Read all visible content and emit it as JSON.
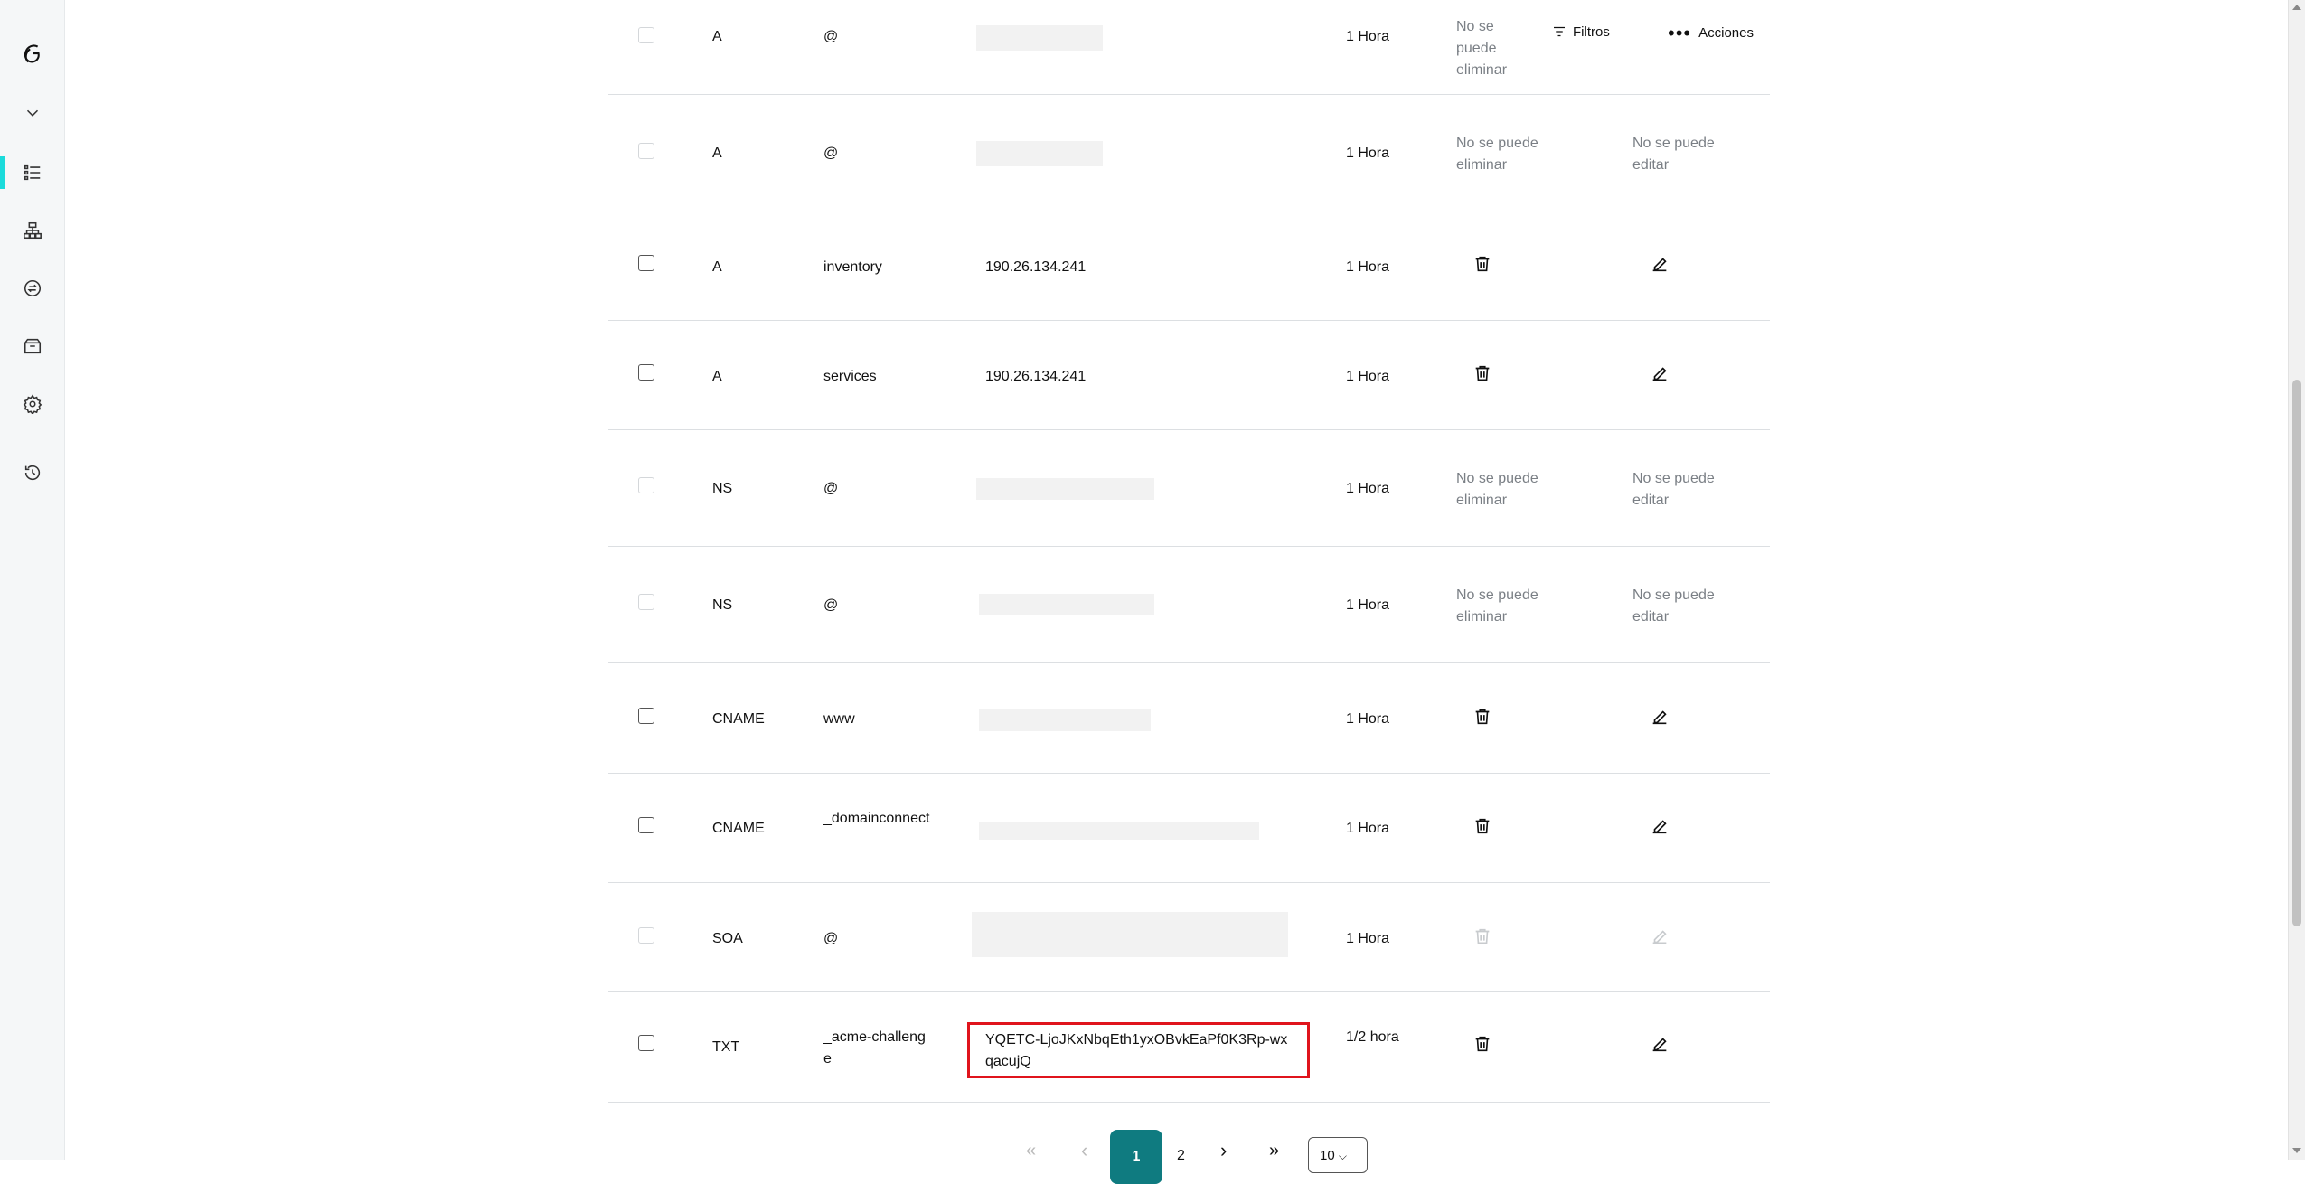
{
  "toolbar": {
    "filters_label": "Filtros",
    "actions_label": "Acciones"
  },
  "rail": {
    "items": [
      {
        "icon": "godaddy-logo-icon"
      },
      {
        "icon": "chevron-down-icon"
      },
      {
        "icon": "dns-records-icon",
        "active": true
      },
      {
        "icon": "hierarchy-icon"
      },
      {
        "icon": "transfer-icon"
      },
      {
        "icon": "box-icon"
      },
      {
        "icon": "gear-icon"
      },
      {
        "icon": "history-icon"
      }
    ]
  },
  "labels": {
    "cannot_delete": "No se puede eliminar",
    "cannot_edit": "No se puede editar"
  },
  "records": [
    {
      "type": "A",
      "name": "@",
      "value": "",
      "ttl": "1 Hora"
    },
    {
      "type": "A",
      "name": "@",
      "value": "",
      "ttl": "1 Hora"
    },
    {
      "type": "A",
      "name": "inventory",
      "value": "190.26.134.241",
      "ttl": "1 Hora"
    },
    {
      "type": "A",
      "name": "services",
      "value": "190.26.134.241",
      "ttl": "1 Hora"
    },
    {
      "type": "NS",
      "name": "@",
      "value": "",
      "ttl": "1 Hora"
    },
    {
      "type": "NS",
      "name": "@",
      "value": "",
      "ttl": "1 Hora"
    },
    {
      "type": "CNAME",
      "name": "www",
      "value": "",
      "ttl": "1 Hora"
    },
    {
      "type": "CNAME",
      "name": "_domainconnect",
      "value": "",
      "ttl": "1 Hora"
    },
    {
      "type": "SOA",
      "name": "@",
      "value": "",
      "ttl": "1 Hora"
    },
    {
      "type": "TXT",
      "name": "_acme-challenge",
      "value": "YQETC-LjoJKxNbqEth1yxOBvkEaPf0K3Rp-wxqacujQ",
      "ttl": "1/2 hora"
    }
  ],
  "pagination": {
    "first": "«",
    "prev": "‹",
    "current": "1",
    "page2": "2",
    "next": "›",
    "last": "»",
    "page_size": "10"
  }
}
